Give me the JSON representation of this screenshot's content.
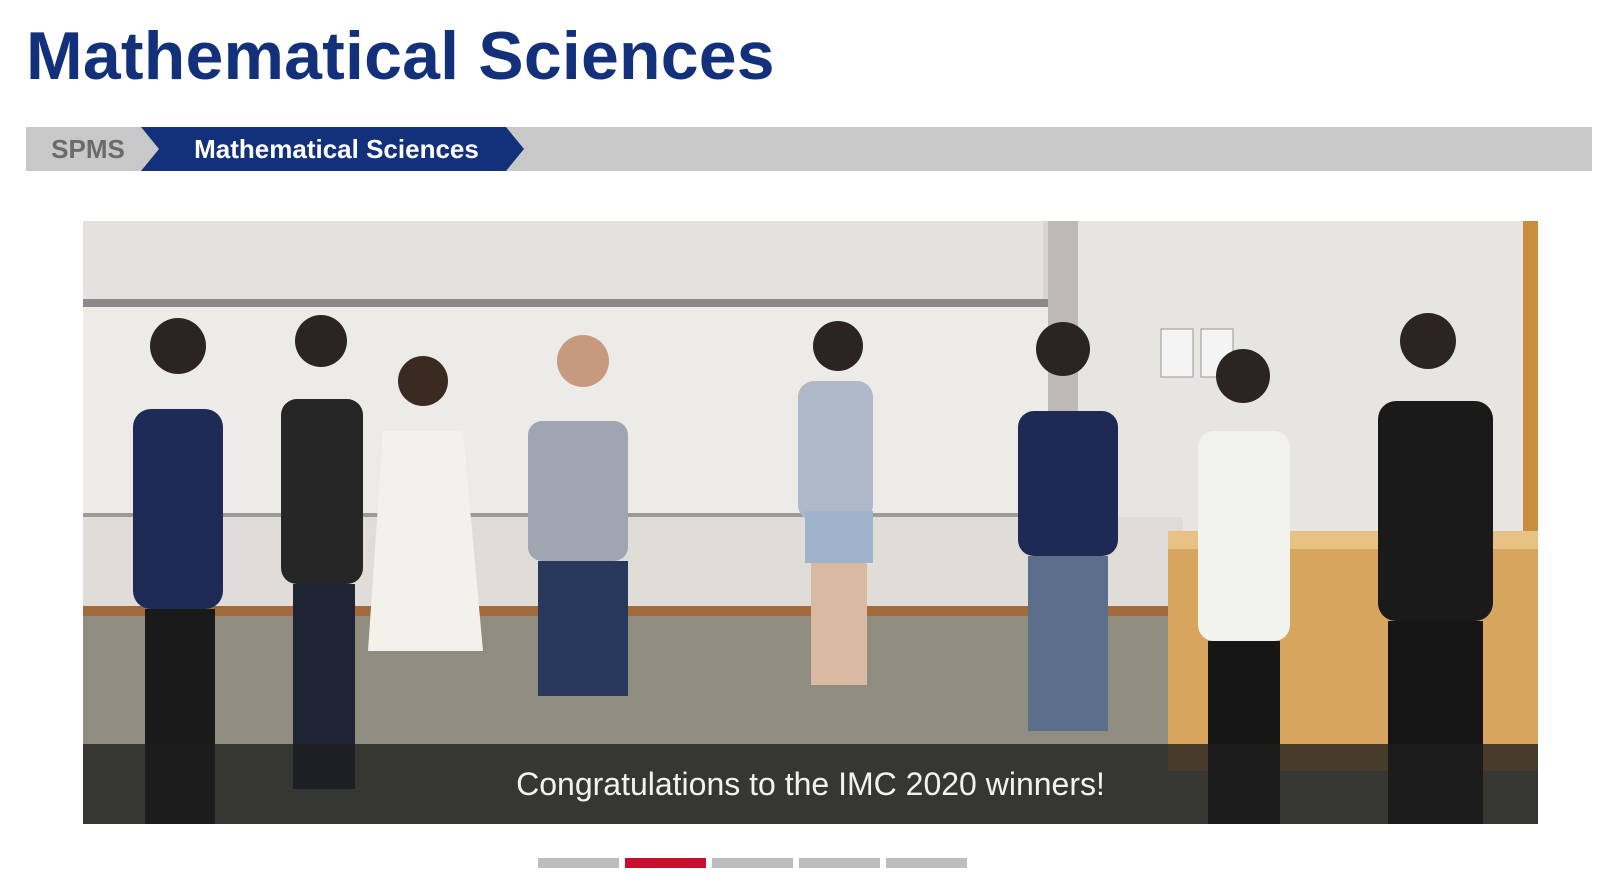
{
  "header": {
    "title": "Mathematical Sciences"
  },
  "breadcrumb": {
    "items": [
      {
        "label": "SPMS"
      },
      {
        "label": "Mathematical Sciences"
      }
    ]
  },
  "slider": {
    "image_description_icon": "group-photo",
    "caption": "Congratulations to the IMC 2020 winners!",
    "dot_count": 5,
    "active_index": 1
  },
  "colors": {
    "title": "#13307a",
    "breadcrumb_active": "#13307a",
    "breadcrumb_bg": "#c8c8c8",
    "dot_active": "#c8102e",
    "dot_inactive": "#bdbdbd"
  }
}
